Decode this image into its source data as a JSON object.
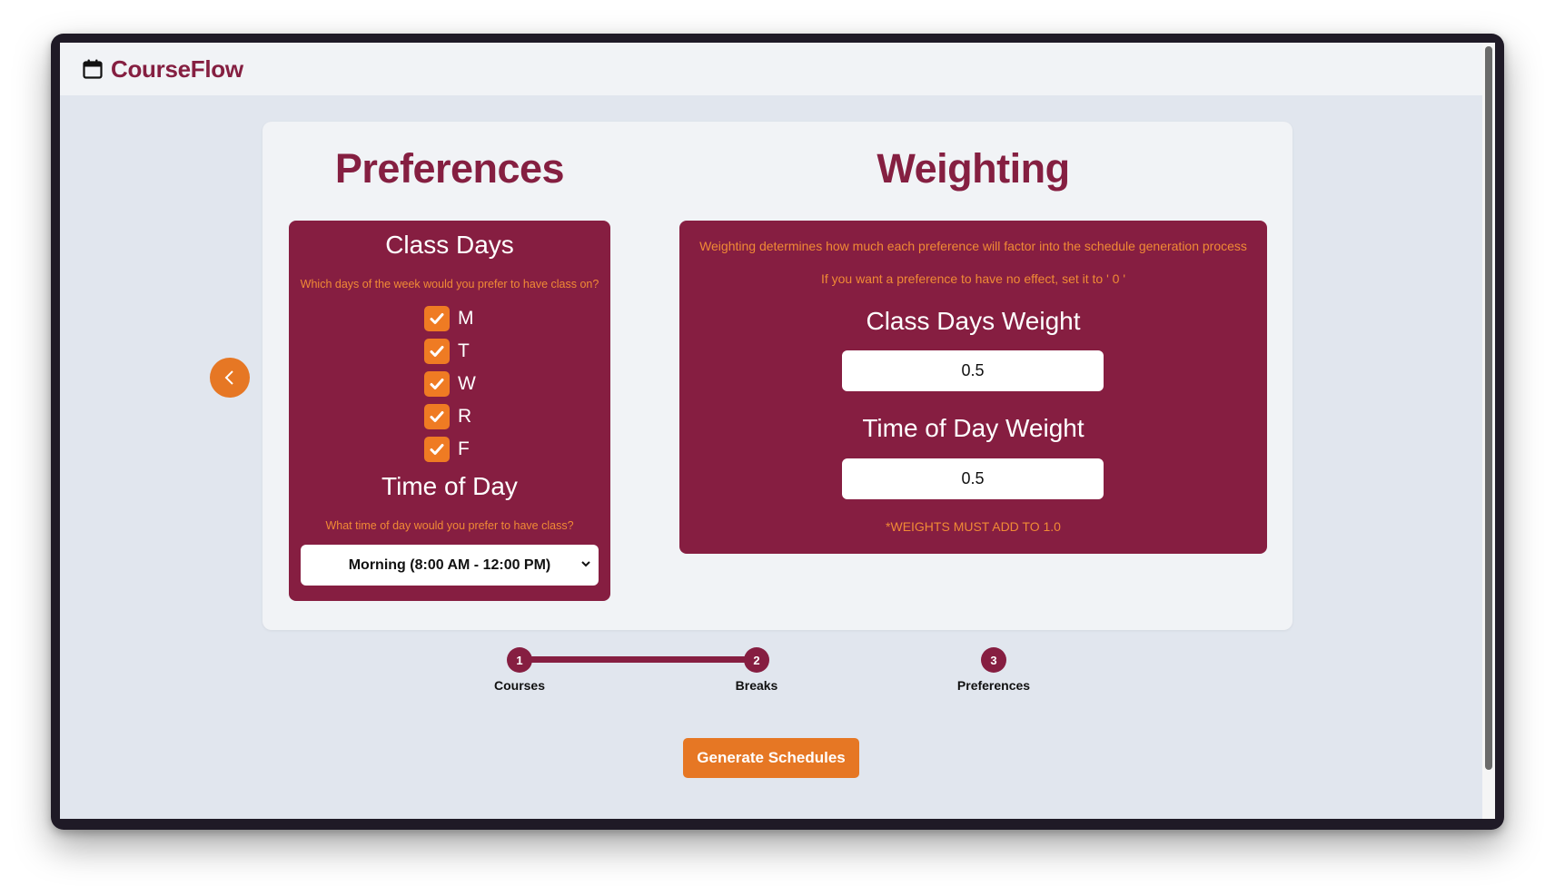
{
  "app": {
    "name": "CourseFlow",
    "logo_icon": "calendar-icon"
  },
  "colors": {
    "brand": "#851f41",
    "panel": "#861e41",
    "accent": "#e67724",
    "hint": "#f08a35"
  },
  "preferences": {
    "title": "Preferences",
    "class_days": {
      "heading": "Class Days",
      "hint": "Which days of the week would you prefer to have class on?",
      "days": [
        {
          "label": "M",
          "checked": true
        },
        {
          "label": "T",
          "checked": true
        },
        {
          "label": "W",
          "checked": true
        },
        {
          "label": "R",
          "checked": true
        },
        {
          "label": "F",
          "checked": true
        }
      ]
    },
    "time_of_day": {
      "heading": "Time of Day",
      "hint": "What time of day would you prefer to have class?",
      "selected": "Morning (8:00 AM - 12:00 PM)"
    }
  },
  "weighting": {
    "title": "Weighting",
    "description": "Weighting determines how much each preference will factor into the schedule generation process",
    "note": "If you want a preference to have no effect, set it to ' 0 '",
    "class_days_label": "Class Days Weight",
    "class_days_value": "0.5",
    "time_of_day_label": "Time of Day Weight",
    "time_of_day_value": "0.5",
    "warning": "*WEIGHTS MUST ADD TO 1.0"
  },
  "stepper": {
    "steps": [
      {
        "number": "1",
        "label": "Courses"
      },
      {
        "number": "2",
        "label": "Breaks"
      },
      {
        "number": "3",
        "label": "Preferences"
      }
    ]
  },
  "actions": {
    "generate_label": "Generate Schedules",
    "back_icon": "chevron-left-icon"
  }
}
